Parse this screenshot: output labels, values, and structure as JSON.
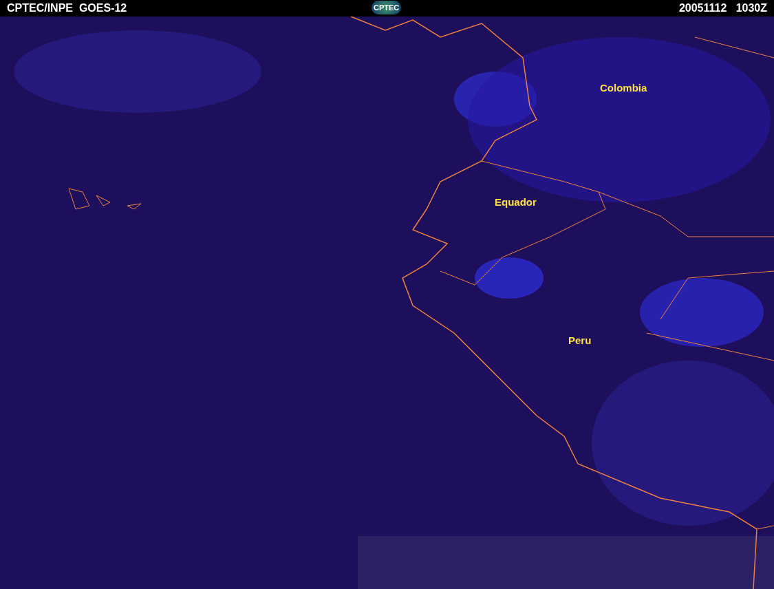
{
  "header": {
    "title": "CPTEC/INPE  GOES-12",
    "logo": "CPTEC",
    "timestamp": "20051112   1030Z"
  },
  "map": {
    "labels": [
      {
        "text": "Colombia"
      },
      {
        "text": "Equador"
      },
      {
        "text": "Peru"
      }
    ]
  }
}
